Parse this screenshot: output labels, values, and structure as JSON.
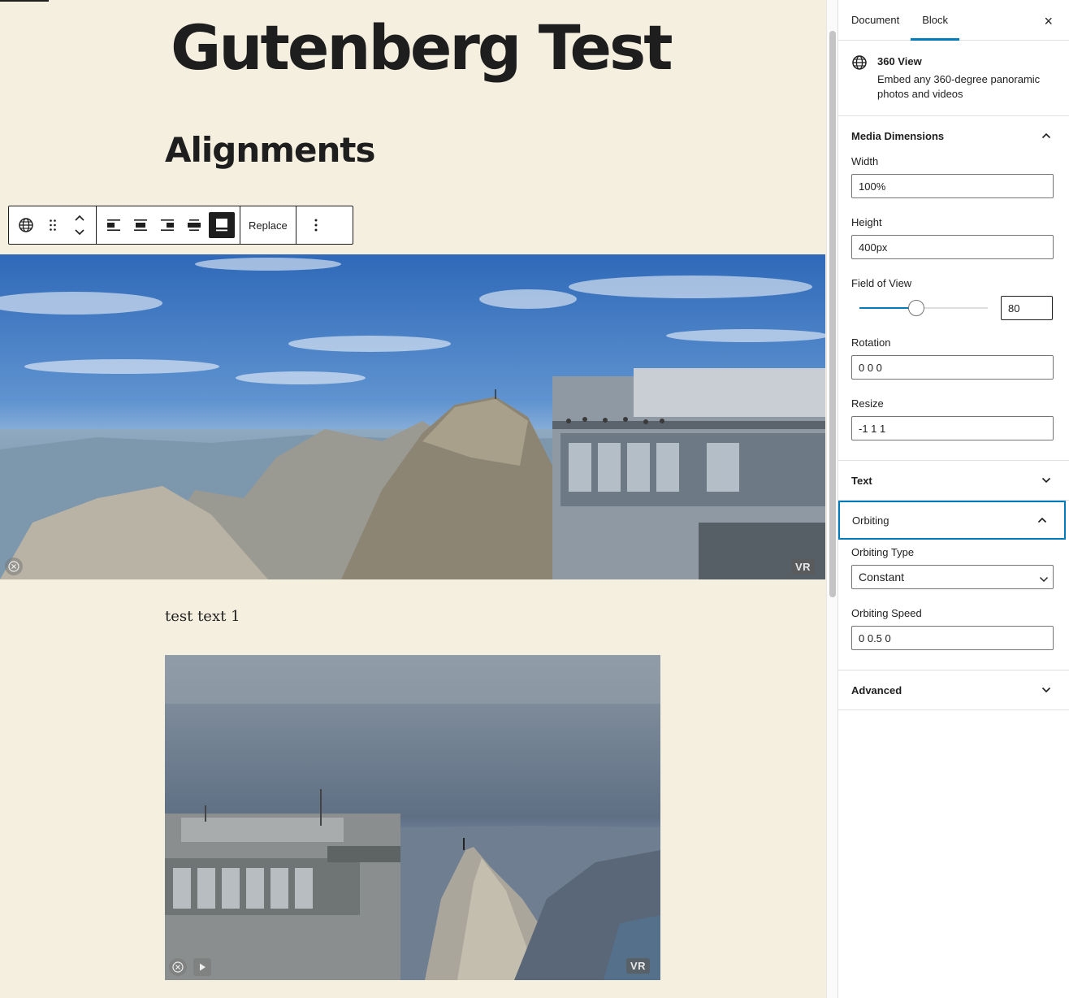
{
  "editor": {
    "post_title": "Gutenberg Test",
    "heading": "Alignments",
    "paragraph": "test text 1",
    "toolbar": {
      "replace_label": "Replace",
      "active_alignment": "full-width"
    },
    "panorama_1": {
      "vr_label": "VR"
    },
    "panorama_2": {
      "vr_label": "VR"
    }
  },
  "sidebar": {
    "tabs": [
      {
        "label": "Document",
        "active": false
      },
      {
        "label": "Block",
        "active": true
      }
    ],
    "close_label": "×",
    "block": {
      "icon": "globe-icon",
      "name": "360 View",
      "description": "Embed any 360-degree panoramic photos and videos"
    },
    "panels": {
      "media_dimensions": {
        "title": "Media Dimensions",
        "expanded": true,
        "width_label": "Width",
        "width_value": "100%",
        "height_label": "Height",
        "height_value": "400px",
        "fov_label": "Field of View",
        "fov_value": "80",
        "fov_fraction": 0.44,
        "rotation_label": "Rotation",
        "rotation_value": "0 0 0",
        "resize_label": "Resize",
        "resize_value": "-1 1 1"
      },
      "text": {
        "title": "Text",
        "expanded": false
      },
      "orbiting": {
        "title": "Orbiting",
        "expanded": true,
        "type_label": "Orbiting Type",
        "type_value": "Constant",
        "speed_label": "Orbiting Speed",
        "speed_value": "0 0.5 0"
      },
      "advanced": {
        "title": "Advanced",
        "expanded": false
      }
    }
  },
  "colors": {
    "canvas_bg": "#f5efe0",
    "accent": "#007cba",
    "text": "#1e1e1e"
  }
}
